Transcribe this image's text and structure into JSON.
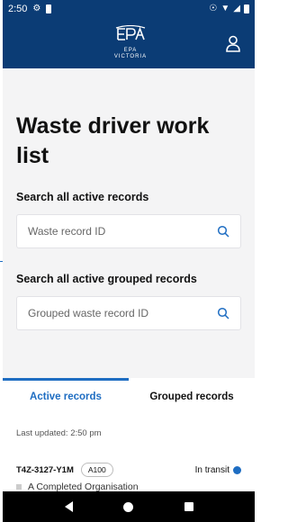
{
  "status_bar": {
    "time": "2:50",
    "settings_icon": "gear-icon",
    "storage_icon": "sd-card-icon",
    "location_icon": "location-icon",
    "wifi_icon": "wifi-icon",
    "signal_icon": "signal-icon",
    "battery_icon": "battery-icon"
  },
  "header": {
    "logo_mark": "EPA",
    "logo_line1": "EPA",
    "logo_line2": "VICTORIA",
    "profile_icon": "user-icon",
    "background": "#0b3c75"
  },
  "page": {
    "title": "Waste driver work list"
  },
  "search_active": {
    "label": "Search all active records",
    "placeholder": "Waste record ID",
    "icon": "search-icon"
  },
  "search_grouped": {
    "label": "Search all active grouped records",
    "placeholder": "Grouped waste record ID",
    "icon": "search-icon"
  },
  "tabs": [
    {
      "label": "Active records",
      "active": true
    },
    {
      "label": "Grouped records",
      "active": false
    }
  ],
  "last_updated": "Last updated: 2:50 pm",
  "records": [
    {
      "id": "T4Z-3127-Y1M",
      "badge": "A100",
      "status": "In transit",
      "status_color": "#1e6dc2",
      "organisation": "A Completed Organisation"
    }
  ],
  "accent_color": "#1e6dc2"
}
